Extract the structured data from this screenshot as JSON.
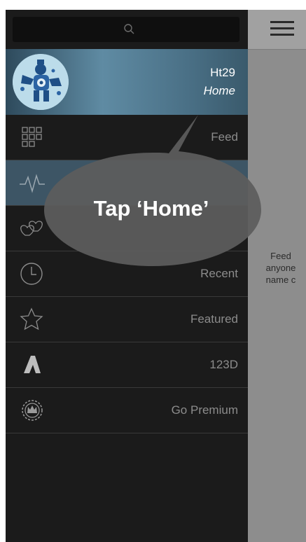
{
  "search": {
    "icon": "search-icon"
  },
  "profile": {
    "name": "Ht29",
    "subtitle": "Home",
    "avatar": "robot-avatar"
  },
  "menu": [
    {
      "label": "Feed",
      "icon": "grid-icon",
      "active": false
    },
    {
      "label": "",
      "icon": "activity-icon",
      "active": true
    },
    {
      "label": "",
      "icon": "hearts-icon",
      "active": false
    },
    {
      "label": "Recent",
      "icon": "clock-icon",
      "active": false
    },
    {
      "label": "Featured",
      "icon": "star-icon",
      "active": false
    },
    {
      "label": "123D",
      "icon": "autodesk-a-icon",
      "active": false
    },
    {
      "label": "Go Premium",
      "icon": "crown-badge-icon",
      "active": false
    }
  ],
  "content": {
    "menu_icon": "hamburger-icon",
    "line1": "Feed",
    "line2": "anyone",
    "line3": "name c"
  },
  "callout": {
    "text": "Tap ‘Home’"
  }
}
